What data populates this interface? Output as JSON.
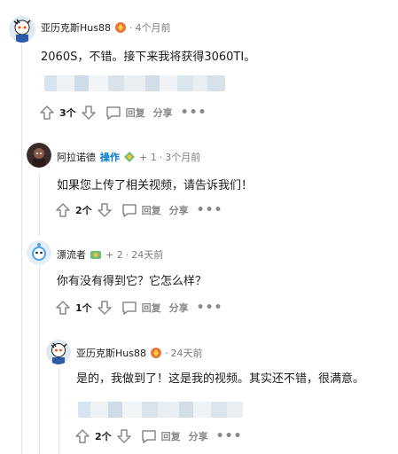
{
  "colors": {
    "accent": "#0079d3",
    "meta_gray": "#7c7c7c",
    "icon_gray": "#878a8c"
  },
  "comments": [
    {
      "author": "亚历克斯Hus88",
      "flair_icon": "award-icon",
      "time": "4个月前",
      "text": "2060S，不错。接下来我将获得3060TI。",
      "votes": "3个",
      "reply": "回复",
      "share": "分享",
      "more": "•••"
    },
    {
      "author": "阿拉诺德",
      "op_tag": "操作",
      "flair_icon": "badge-icon",
      "score": "+ 1",
      "time": "3个月前",
      "text": "如果您上传了相关视频，请告诉我们！",
      "votes": "2个",
      "reply": "回复",
      "share": "分享",
      "more": "•••"
    },
    {
      "author": "漂流者",
      "flair_icon": "badge-icon",
      "score": "+ 2",
      "time": "24天前",
      "text": "你有没有得到它？它怎么样？",
      "votes": "1个",
      "reply": "回复",
      "share": "分享",
      "more": "•••"
    },
    {
      "author": "亚历克斯Hus88",
      "flair_icon": "award-icon",
      "time": "24天前",
      "text": "是的，我做到了！这是我的视频。其实还不错，很满意。",
      "votes": "2个",
      "reply": "回复",
      "share": "分享",
      "more": "•••"
    }
  ]
}
